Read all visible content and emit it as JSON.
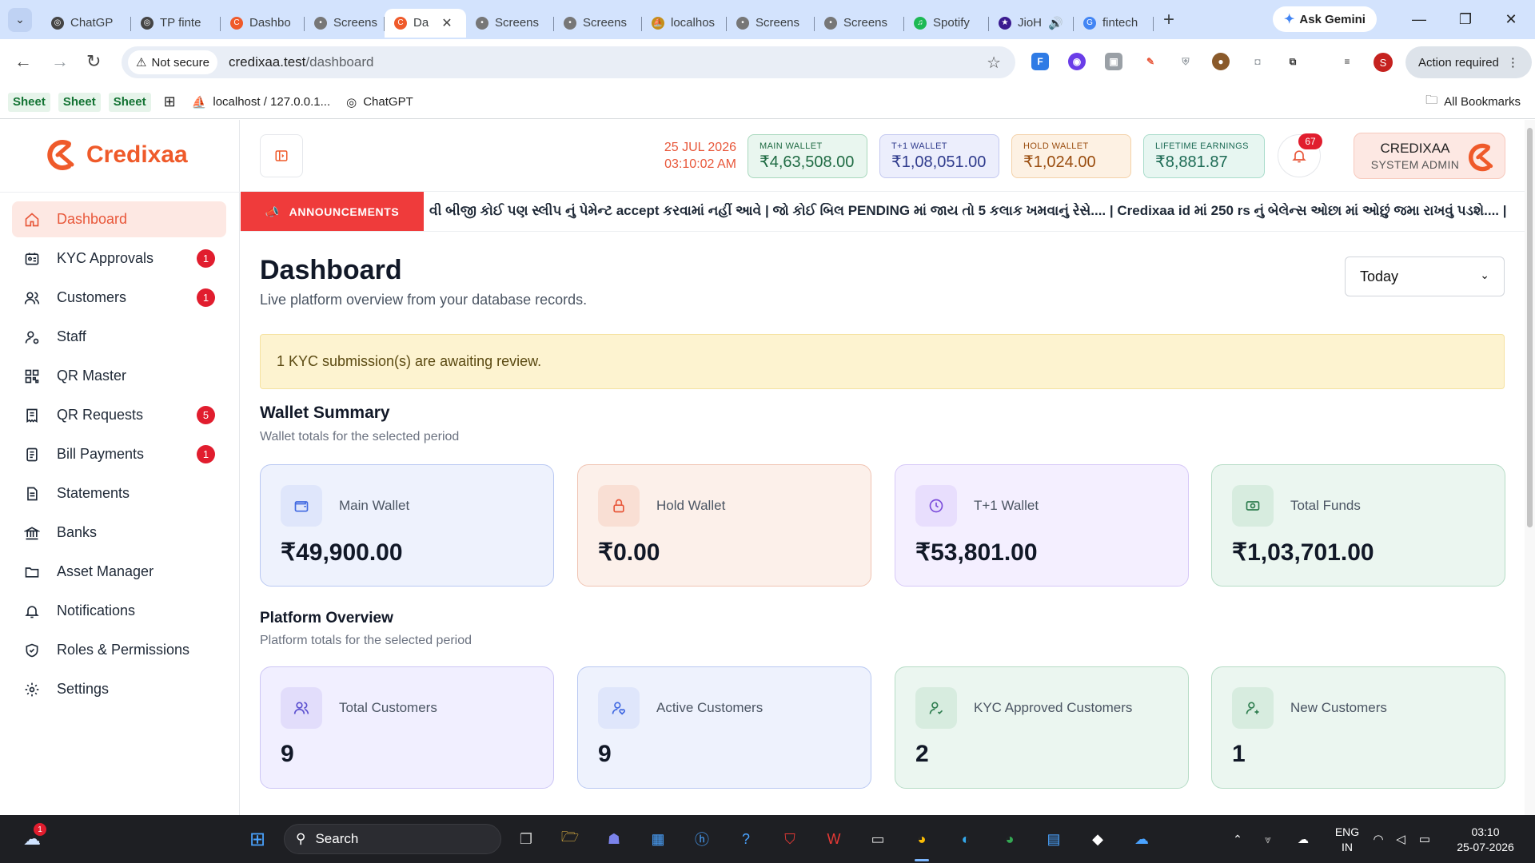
{
  "browser": {
    "tabs": [
      {
        "label": "ChatGP",
        "icon": "chatgpt-icon",
        "color": "#444444"
      },
      {
        "label": "TP finte",
        "icon": "chatgpt-icon",
        "color": "#444444"
      },
      {
        "label": "Dashbo",
        "icon": "credixaa-icon",
        "color": "#ef5a2a"
      },
      {
        "label": "Screens",
        "icon": "globe-icon",
        "color": "#777777"
      },
      {
        "label": "Da",
        "icon": "credixaa-icon",
        "color": "#ef5a2a",
        "active": true
      },
      {
        "label": "Screens",
        "icon": "globe-icon",
        "color": "#777777"
      },
      {
        "label": "Screens",
        "icon": "globe-icon",
        "color": "#777777"
      },
      {
        "label": "localhos",
        "icon": "phpmyadmin-icon",
        "color": "#c58f1a"
      },
      {
        "label": "Screens",
        "icon": "globe-icon",
        "color": "#777777"
      },
      {
        "label": "Screens",
        "icon": "globe-icon",
        "color": "#777777"
      },
      {
        "label": "Spotify",
        "icon": "spotify-icon",
        "color": "#1db954"
      },
      {
        "label": "JioH",
        "icon": "jiohotstar-icon",
        "color": "#3a1a8f"
      },
      {
        "label": "fintech",
        "icon": "google-icon",
        "color": "#4285f4"
      }
    ],
    "ask_gemini": "Ask Gemini",
    "not_secure": "Not secure",
    "url_host": "credixaa.test",
    "url_path": "/dashboard",
    "action_required": "Action required",
    "profile_letter": "S",
    "bookmarks": {
      "sheet1": "Sheet",
      "sheet2": "Sheet",
      "sheet3": "Sheet",
      "localhost": "localhost / 127.0.0.1...",
      "chatgpt": "ChatGPT",
      "all": "All Bookmarks"
    }
  },
  "app": {
    "brand": "Credixaa",
    "brand_color": "#ef5a2a",
    "sidebar": {
      "items": [
        {
          "label": "Dashboard",
          "icon": "home-icon",
          "active": true
        },
        {
          "label": "KYC Approvals",
          "icon": "id-card-icon",
          "badge": "1"
        },
        {
          "label": "Customers",
          "icon": "users-icon",
          "badge": "1"
        },
        {
          "label": "Staff",
          "icon": "user-cog-icon"
        },
        {
          "label": "QR Master",
          "icon": "qr-code-icon"
        },
        {
          "label": "QR Requests",
          "icon": "receipt-icon",
          "badge": "5"
        },
        {
          "label": "Bill Payments",
          "icon": "bill-icon",
          "badge": "1"
        },
        {
          "label": "Statements",
          "icon": "document-icon"
        },
        {
          "label": "Banks",
          "icon": "bank-icon"
        },
        {
          "label": "Asset Manager",
          "icon": "folder-icon"
        },
        {
          "label": "Notifications",
          "icon": "bell-icon"
        },
        {
          "label": "Roles & Permissions",
          "icon": "shield-icon"
        },
        {
          "label": "Settings",
          "icon": "gear-icon"
        }
      ]
    },
    "topbar": {
      "date": "25 JUL 2026",
      "time": "03:10:02 AM",
      "wallets": [
        {
          "label": "MAIN WALLET",
          "value": "₹4,63,508.00",
          "bg": "#e9f6ef",
          "border": "#a8d8bd",
          "color": "#1f6b43"
        },
        {
          "label": "T+1 WALLET",
          "value": "₹1,08,051.00",
          "bg": "#eceefc",
          "border": "#c3c8f0",
          "color": "#2e3a8c"
        },
        {
          "label": "HOLD WALLET",
          "value": "₹1,024.00",
          "bg": "#fdf1e3",
          "border": "#f3d1a8",
          "color": "#9a4d0f"
        },
        {
          "label": "LIFETIME EARNINGS",
          "value": "₹8,881.87",
          "bg": "#e7f6f1",
          "border": "#a9dccb",
          "color": "#1d6b55"
        }
      ],
      "notifications_count": "67",
      "user_name": "CREDIXAA",
      "user_role": "SYSTEM ADMIN"
    },
    "announcement": {
      "label": "ANNOUNCEMENTS",
      "text": "વી બીજી કોઈ પણ સ્લીપ નું પેમેન્ટ accept કરવામાં નહીં આવે | જો કોઈ બિલ PENDING માં જાય તો 5 કલાક ખમવાનું રેસે.... | Credixaa id માં 250 rs નું બેલેન્સ ઓછા માં ઓછું જમા રાખવું પડશે.... |"
    },
    "page": {
      "title": "Dashboard",
      "subtitle": "Live platform overview from your database records.",
      "period": "Today",
      "alert": "1 KYC submission(s) are awaiting review.",
      "wallet_summary": {
        "title": "Wallet Summary",
        "subtitle": "Wallet totals for the selected period",
        "cards": [
          {
            "label": "Main Wallet",
            "value": "₹49,900.00",
            "icon": "wallet-icon",
            "theme": "c-blue"
          },
          {
            "label": "Hold Wallet",
            "value": "₹0.00",
            "icon": "lock-icon",
            "theme": "c-peach"
          },
          {
            "label": "T+1 Wallet",
            "value": "₹53,801.00",
            "icon": "clock-icon",
            "theme": "c-lav"
          },
          {
            "label": "Total Funds",
            "value": "₹1,03,701.00",
            "icon": "cash-icon",
            "theme": "c-green"
          }
        ]
      },
      "platform_overview": {
        "title": "Platform Overview",
        "subtitle": "Platform totals for the selected period",
        "cards": [
          {
            "label": "Total Customers",
            "value": "9",
            "icon": "users-icon",
            "theme": "c-lav2"
          },
          {
            "label": "Active Customers",
            "value": "9",
            "icon": "user-heart-icon",
            "theme": "c-blue"
          },
          {
            "label": "KYC Approved Customers",
            "value": "2",
            "icon": "user-check-icon",
            "theme": "c-green"
          },
          {
            "label": "New Customers",
            "value": "1",
            "icon": "user-plus-icon",
            "theme": "c-green"
          }
        ]
      }
    }
  },
  "taskbar": {
    "search_placeholder": "Search",
    "weather_badge": "1",
    "lang_top": "ENG",
    "lang_bottom": "IN",
    "clock_time": "03:10",
    "clock_date": "25-07-2026"
  }
}
